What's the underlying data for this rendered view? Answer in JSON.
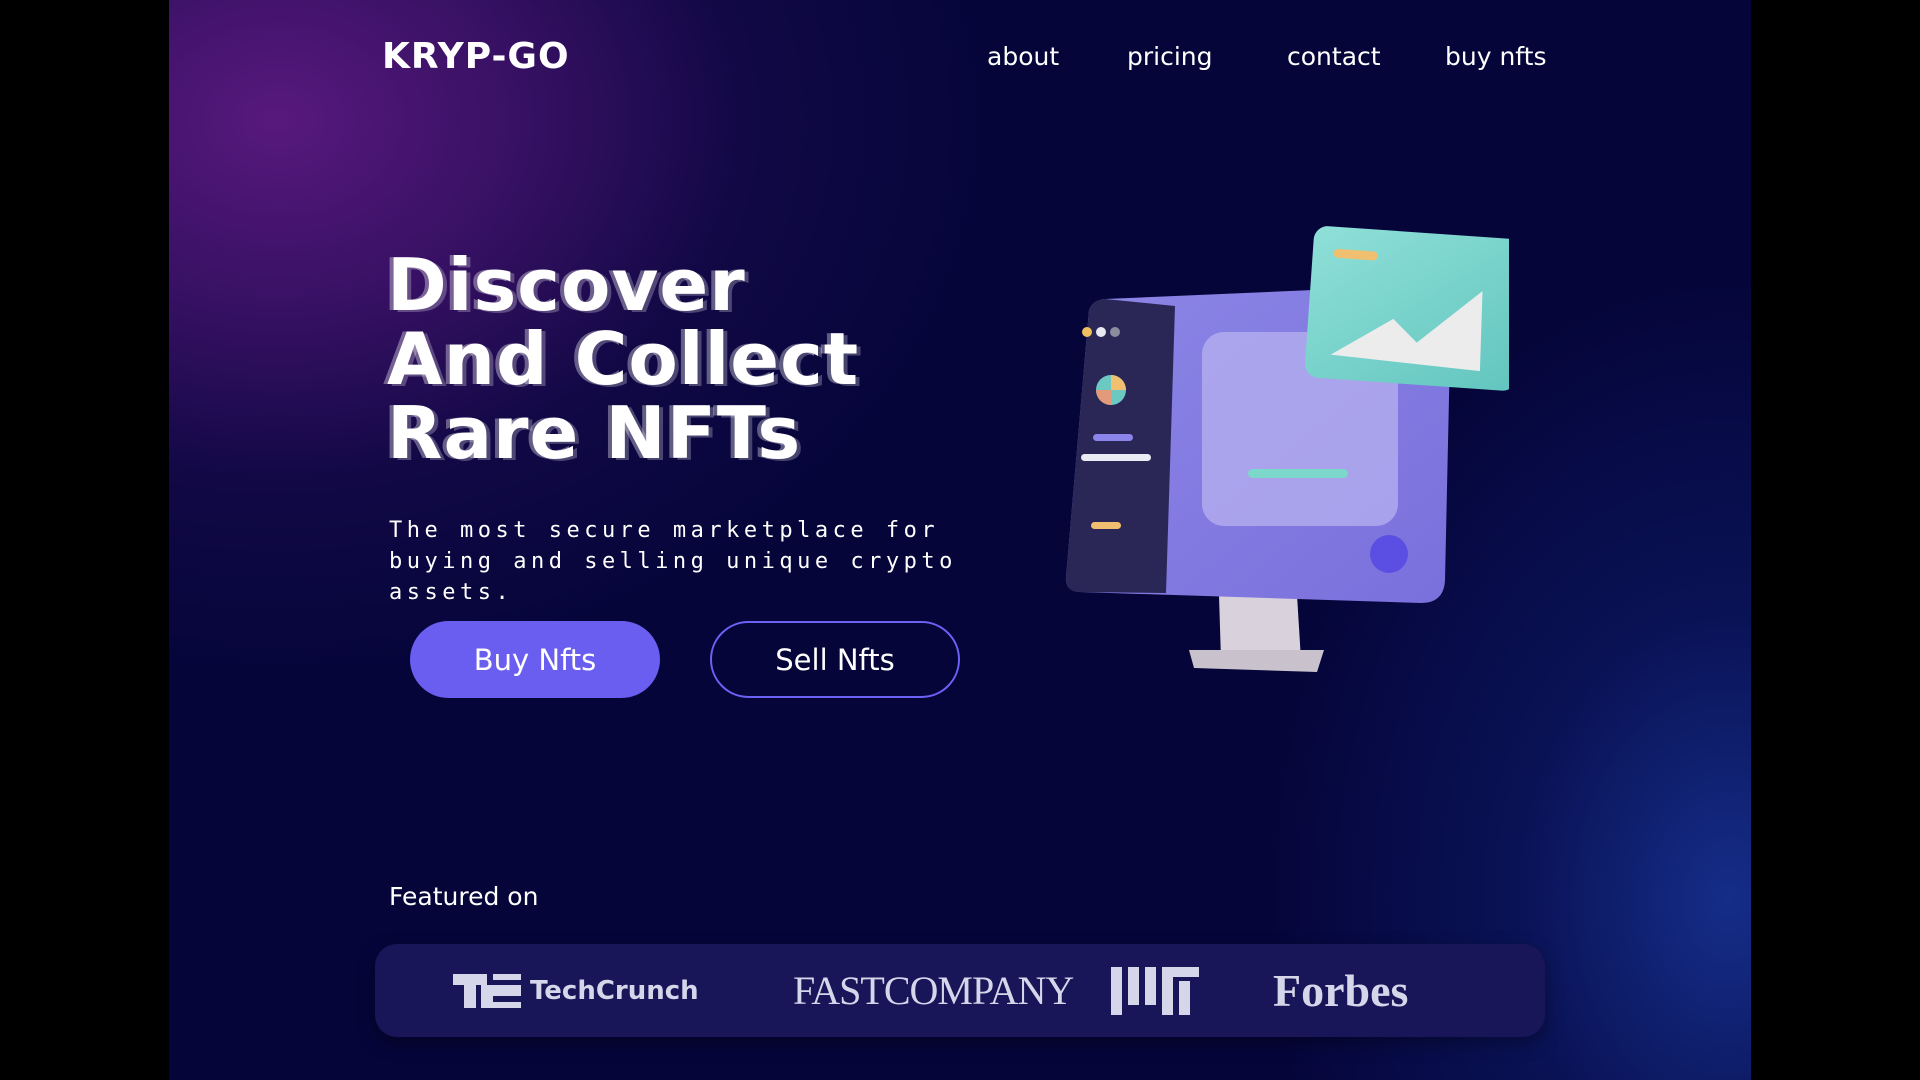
{
  "header": {
    "brand": "KRYP-GO",
    "nav": [
      {
        "label": "about"
      },
      {
        "label": "pricing"
      },
      {
        "label": "contact"
      },
      {
        "label": "buy nfts"
      }
    ]
  },
  "hero": {
    "headline": [
      "Discover",
      "And Collect",
      "Rare NFTs"
    ],
    "subtitle": "The most secure marketplace for buying and selling unique crypto assets.",
    "buttons": {
      "buy": "Buy Nfts",
      "sell": "Sell Nfts"
    }
  },
  "featured": {
    "label": "Featured on",
    "logos": [
      {
        "name": "TechCrunch",
        "icon": "techcrunch-logo"
      },
      {
        "name": "FASTCOMPANY",
        "icon": "fastcompany-logo"
      },
      {
        "name": "MIT",
        "icon": "mit-logo"
      },
      {
        "name": "Forbes",
        "icon": "forbes-logo"
      }
    ]
  },
  "colors": {
    "accent": "#6a5ef0",
    "background": "#05053a",
    "purple_glow": "#5c1a80",
    "blue_glow": "#18349a",
    "press_bar": "#181559"
  }
}
